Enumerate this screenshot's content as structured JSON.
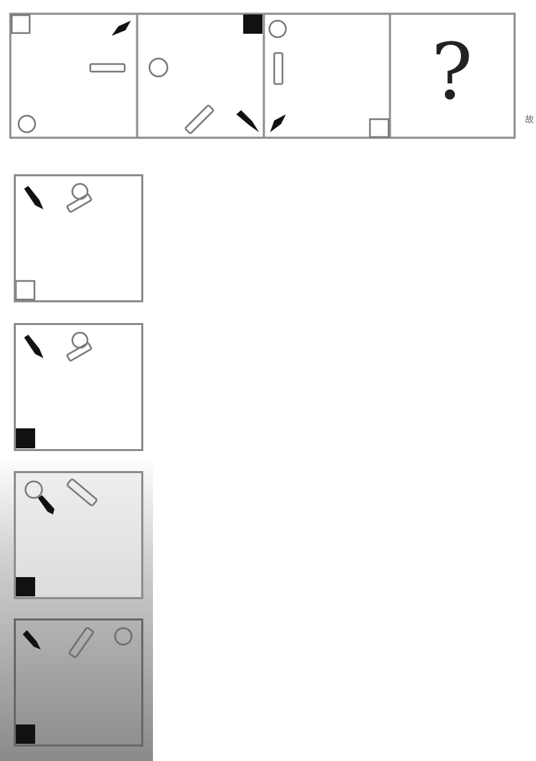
{
  "question": {
    "unknown_symbol": "?",
    "side_mark": "故"
  },
  "panels": [
    {
      "id": "panel-1",
      "figures": [
        "outline-square",
        "black-wedge",
        "outline-bar",
        "outline-circle"
      ]
    },
    {
      "id": "panel-2",
      "figures": [
        "black-square",
        "outline-circle",
        "outline-bar",
        "black-wedge"
      ]
    },
    {
      "id": "panel-3",
      "figures": [
        "outline-circle",
        "outline-bar",
        "black-wedge",
        "outline-square"
      ]
    },
    {
      "id": "panel-4",
      "figures": [
        "question-mark"
      ]
    }
  ],
  "options": [
    {
      "id": "option-1",
      "figures": [
        "black-wedge",
        "outline-circle",
        "outline-bar",
        "outline-square"
      ]
    },
    {
      "id": "option-2",
      "figures": [
        "black-wedge",
        "outline-circle",
        "outline-bar",
        "black-square"
      ]
    },
    {
      "id": "option-3",
      "figures": [
        "outline-circle",
        "black-wedge",
        "outline-bar",
        "black-square"
      ]
    },
    {
      "id": "option-4",
      "figures": [
        "black-wedge",
        "outline-bar",
        "outline-circle",
        "black-square"
      ]
    }
  ],
  "colors": {
    "frame": "#8c8c8c",
    "shape_outline": "#7a7a7a",
    "shape_fill": "#111111"
  }
}
